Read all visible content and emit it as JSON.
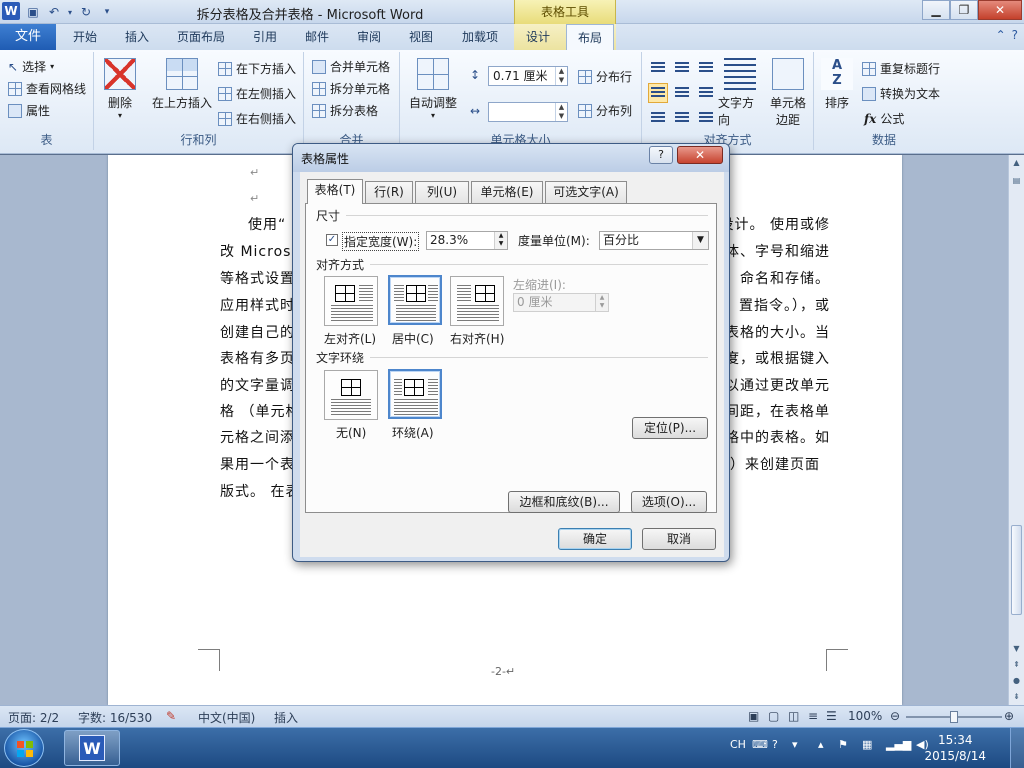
{
  "titlebar": {
    "app_letter": "W",
    "title": "拆分表格及合并表格 - Microsoft Word",
    "table_tools": "表格工具",
    "minimize": "▁",
    "maximize": "❐",
    "close": "✕"
  },
  "tabs": {
    "file": "文件",
    "items": [
      "开始",
      "插入",
      "页面布局",
      "引用",
      "邮件",
      "审阅",
      "视图",
      "加载项",
      "设计",
      "布局"
    ],
    "active": "布局"
  },
  "ribbon": {
    "table_group": {
      "label": "表",
      "select": "选择",
      "view_gridlines": "查看网格线",
      "properties": "属性"
    },
    "rows_cols_group": {
      "label": "行和列",
      "delete": "删除",
      "insert_above": "在上方插入",
      "insert_below": "在下方插入",
      "insert_left": "在左侧插入",
      "insert_right": "在右侧插入"
    },
    "merge_group": {
      "label": "合并",
      "merge_cells": "合并单元格",
      "split_cells": "拆分单元格",
      "split_table": "拆分表格"
    },
    "cell_size_group": {
      "label": "单元格大小",
      "autofit": "自动调整",
      "height_value": "0.71 厘米",
      "width_value": "",
      "distribute_rows": "分布行",
      "distribute_cols": "分布列"
    },
    "alignment_group": {
      "label": "对齐方式",
      "text_direction": "文字方向",
      "cell_margins_1": "单元格",
      "cell_margins_2": "边距"
    },
    "data_group": {
      "label": "数据",
      "sort": "排序",
      "repeat_header": "重复标题行",
      "convert_to_text": "转换为文本",
      "formula": "公式",
      "fx": "fx"
    }
  },
  "document": {
    "para_mark": "↵",
    "lines": [
      {
        "left": "使用“",
        "right": "设计。 使用或修"
      },
      {
        "left": "改 Microso",
        "right": "体、字号和缩进"
      },
      {
        "left": "等格式设置",
        "right": "命名和存储。"
      },
      {
        "left": "应用样式时",
        "right": "置指令。），或"
      },
      {
        "left": "创建自己的",
        "right": "表格的大小。当"
      },
      {
        "left": "表格有多页",
        "right": "度，或根据键入"
      },
      {
        "left": "的文字量调",
        "right": "以通过更改单元"
      },
      {
        "left": "格 （单元格",
        "right": "间距，在表格单"
      },
      {
        "left": "元格之间添",
        "right": "格中的表格。如"
      },
      {
        "left": "果用一个表",
        "right": "）来创建页面"
      },
      {
        "left": "版式。 在表",
        "right": ""
      }
    ],
    "page_number": "-2-↵"
  },
  "statusbar": {
    "page": "页面: 2/2",
    "words": "字数: 16/530",
    "language": "中文(中国)",
    "mode": "插入",
    "zoom": "100%",
    "zoom_level": 1.0
  },
  "taskbar": {
    "ime": "CH",
    "time": "15:34",
    "date": "2015/8/14"
  },
  "dialog": {
    "title": "表格属性",
    "help": "?",
    "close": "✕",
    "tabs": [
      "表格(T)",
      "行(R)",
      "列(U)",
      "单元格(E)",
      "可选文字(A)"
    ],
    "size_section": "尺寸",
    "preferred_width_label": "指定宽度(W):",
    "preferred_width_checked": true,
    "preferred_width_value": "28.3%",
    "measure_in_label": "度量单位(M):",
    "measure_in_value": "百分比",
    "alignment_section": "对齐方式",
    "align_left": "左对齐(L)",
    "align_center": "居中(C)",
    "align_right": "右对齐(H)",
    "selected_alignment": "居中(C)",
    "indent_label": "左缩进(I):",
    "indent_value": "0 厘米",
    "wrap_section": "文字环绕",
    "wrap_none": "无(N)",
    "wrap_around": "环绕(A)",
    "selected_wrap": "环绕(A)",
    "positioning_button": "定位(P)...",
    "borders_button": "边框和底纹(B)...",
    "options_button": "选项(O)...",
    "ok_button": "确定",
    "cancel_button": "取消"
  },
  "colors": {
    "file_tab": "#1f5cb3",
    "table_tools": "#e8dc7a",
    "selection": "#4d86cc"
  }
}
